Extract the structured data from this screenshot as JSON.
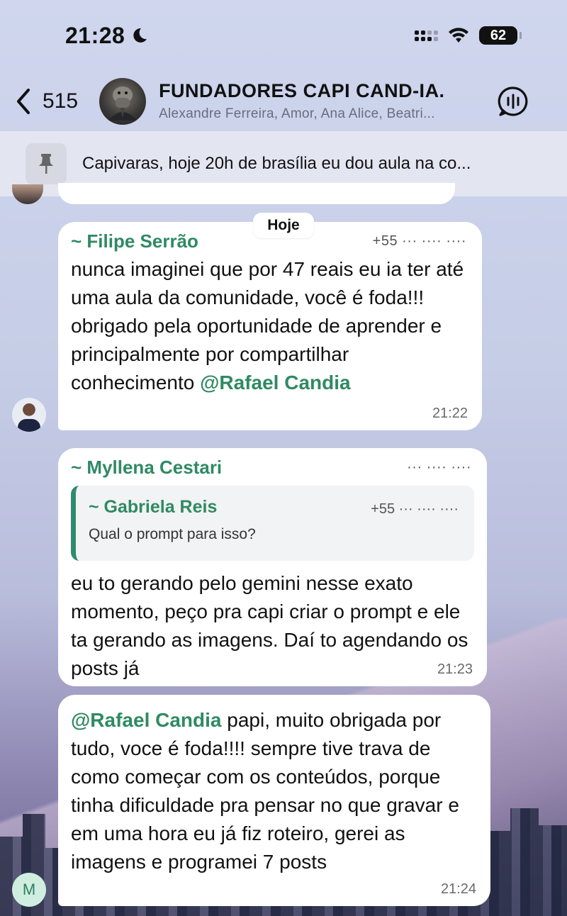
{
  "status_bar": {
    "time": "21:28",
    "battery": "62"
  },
  "header": {
    "back_count": "515",
    "title": "FUNDADORES CAPI CAND-IA.",
    "members": "Alexandre Ferreira, Amor, Ana Alice, Beatri..."
  },
  "pinned": {
    "text": "Capivaras, hoje 20h de brasília eu dou aula na co..."
  },
  "date_separator": "Hoje",
  "messages": [
    {
      "sender": "~ Filipe Serrão",
      "phone": "+55 ··· ···· ····",
      "text": "nunca imaginei que por 47 reais eu ia ter até uma aula da comunidade, você é foda!!! obrigado pela oportunidade de aprender e principalmente por compartilhar conhecimento ",
      "mention": "@Rafael Candia",
      "time": "21:22"
    },
    {
      "sender": "~ Myllena Cestari",
      "phone": "··· ···· ····",
      "quote": {
        "sender": "~ Gabriela Reis",
        "phone": "+55 ··· ···· ····",
        "text": "Qual o prompt para isso?"
      },
      "text": "eu to gerando pelo gemini nesse exato momento, peço pra capi criar o prompt e ele ta gerando as imagens. Daí to agendando os posts já",
      "time": "21:23"
    },
    {
      "mention": "@Rafael Candia",
      "text": " papi, muito obrigada por tudo, voce é foda!!!! sempre tive trava de como começar com os conteúdos, porque tinha dificuldade pra pensar no que gravar e em uma hora eu já fiz roteiro, gerei as imagens e programei 7 posts",
      "time": "21:24",
      "avatar_letter": "M"
    }
  ],
  "colors": {
    "accent_green": "#2f8a63",
    "bubble": "#ffffff"
  }
}
